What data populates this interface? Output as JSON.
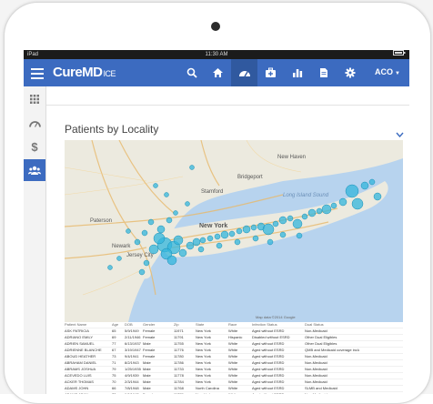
{
  "status_bar": {
    "device": "iPad",
    "time": "11:30 AM"
  },
  "header": {
    "logo_main": "CureMD",
    "logo_suffix": "ICE",
    "user": "ACO"
  },
  "nav_icons": [
    "search-icon",
    "home-icon",
    "dashboard-icon",
    "medkit-icon",
    "bar-chart-icon",
    "document-icon",
    "gear-icon"
  ],
  "sidebar_icons": [
    "grid-icon",
    "dashboard-icon",
    "dollar-icon",
    "users-icon"
  ],
  "panel": {
    "title": "Patients by Locality"
  },
  "map": {
    "labels": [
      "New York",
      "Paterson",
      "Newark",
      "Jersey City",
      "New Haven",
      "Bridgeport",
      "Stamford",
      "Long Island Sound"
    ],
    "footer": "Map data ©2014 Google"
  },
  "table": {
    "headers": [
      "Patient Name",
      "Age",
      "DOB",
      "Gender",
      "Zip",
      "State",
      "Race",
      "Infection Status",
      "Dual Status"
    ],
    "rows": [
      [
        "ASK PATRICIA",
        "65",
        "5/9/1949",
        "Female",
        "11971",
        "New York",
        "White",
        "Aged without ESRD",
        "Non-Medicaid"
      ],
      [
        "ADRIANO EMILY",
        "69",
        "2/11/1946",
        "Female",
        "11791",
        "New York",
        "Hispanic",
        "Disabled without ESRD",
        "Other Dual Eligibles"
      ],
      [
        "ADRIEN SAMUEL",
        "77",
        "6/13/1937",
        "Male",
        "11755",
        "New York",
        "White",
        "Aged without ESRD",
        "Other Dual Eligibles"
      ],
      [
        "ADRIENNE BLANCHE",
        "67",
        "3/19/1947",
        "Female",
        "11776",
        "New York",
        "White",
        "Aged without ESRD",
        "QMB and Medicaid coverage including"
      ],
      [
        "ABOUD HEATHER",
        "73",
        "9/4/1941",
        "Female",
        "11780",
        "New York",
        "White",
        "Aged without ESRD",
        "Non-Medicaid"
      ],
      [
        "ABRAHAM DANIEL",
        "71",
        "8/2/1943",
        "Male",
        "11786",
        "New York",
        "White",
        "Aged without ESRD",
        "Non-Medicaid"
      ],
      [
        "ABRAMS JOSHUA",
        "79",
        "1/25/1935",
        "Male",
        "11733",
        "New York",
        "White",
        "Aged without ESRD",
        "Non-Medicaid"
      ],
      [
        "ACEVEDO LUIS",
        "75",
        "4/9/1939",
        "Male",
        "11778",
        "New York",
        "White",
        "Aged without ESRD",
        "Non-Medicaid"
      ],
      [
        "ACKER THOMAS",
        "70",
        "2/3/1944",
        "Male",
        "11784",
        "New York",
        "White",
        "Aged without ESRD",
        "Non-Medicaid"
      ],
      [
        "ADAMS JOHN",
        "66",
        "7/8/1948",
        "Male",
        "11768",
        "North Carolina",
        "White",
        "Aged without ESRD",
        "SLMB and Medicaid"
      ],
      [
        "ADAMS JOAN",
        "72",
        "6/6/1942",
        "Female",
        "11779",
        "New York",
        "White",
        "Aged without ESRD",
        "Non-Medicaid"
      ]
    ]
  }
}
